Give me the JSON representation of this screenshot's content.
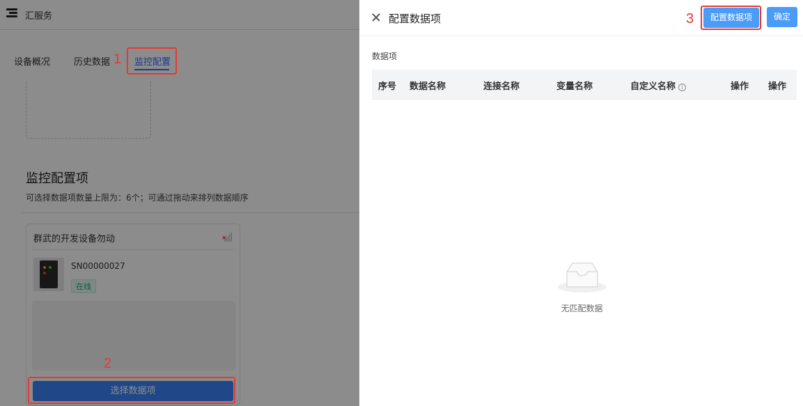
{
  "app": {
    "title": "汇服务",
    "tabs": [
      "设备概况",
      "历史数据",
      "监控配置"
    ],
    "active_tab": "监控配置"
  },
  "monitor": {
    "title": "监控配置项",
    "description": "可选择数据项数量上限为：6个；可通过拖动来排列数据顺序"
  },
  "device_card": {
    "name": "群武的开发设备勿动",
    "serial": "SN00000027",
    "status": "在线",
    "select_button": "选择数据项"
  },
  "drawer": {
    "title": "配置数据项",
    "config_button": "配置数据项",
    "confirm_button": "确定",
    "section_label": "数据项",
    "columns": [
      "序号",
      "数据名称",
      "连接名称",
      "变量名称",
      "自定义名称",
      "操作",
      "操作"
    ],
    "empty_text": "无匹配数据"
  },
  "annotations": [
    "1",
    "2",
    "3"
  ],
  "colors": {
    "accent": "#2f6bff",
    "button": "#4a9cf8",
    "annotation": "#e53935",
    "online": "#1aa37a"
  },
  "icons": [
    "menu-icon",
    "signal-icon",
    "close-icon",
    "info-icon",
    "empty-box-icon"
  ]
}
